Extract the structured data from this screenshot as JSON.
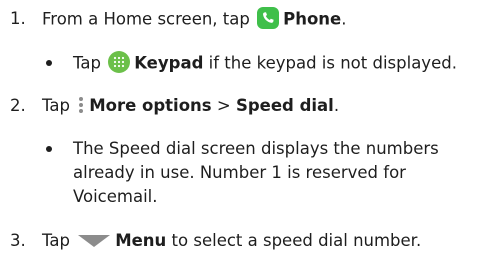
{
  "steps": [
    {
      "number": "1.",
      "text_before": "From a Home screen, tap",
      "bold": "Phone",
      "text_after": "."
    },
    {
      "number": "2.",
      "text_before": "Tap",
      "bold": "More options",
      "separator": ">",
      "bold2": "Speed dial",
      "text_after": "."
    },
    {
      "number": "3.",
      "text_before": "Tap",
      "bold": "Menu",
      "text_after": "to select a speed dial number."
    }
  ],
  "bullets": [
    {
      "text_before": "Tap",
      "bold": "Keypad",
      "text_after": "if the keypad is not displayed."
    },
    {
      "lines": [
        "The Speed dial screen displays the numbers",
        "already in use. Number 1 is reserved for",
        "Voicemail."
      ]
    }
  ],
  "colors": {
    "text": "#1e1e1e",
    "phone_icon": "#3fbf4a",
    "keypad_icon": "#6cc04a",
    "more_icon": "#8c8c8c",
    "menu_icon": "#8c8c8c"
  },
  "icons": [
    "phone-icon",
    "keypad-icon",
    "more-options-icon",
    "menu-triangle-icon"
  ]
}
